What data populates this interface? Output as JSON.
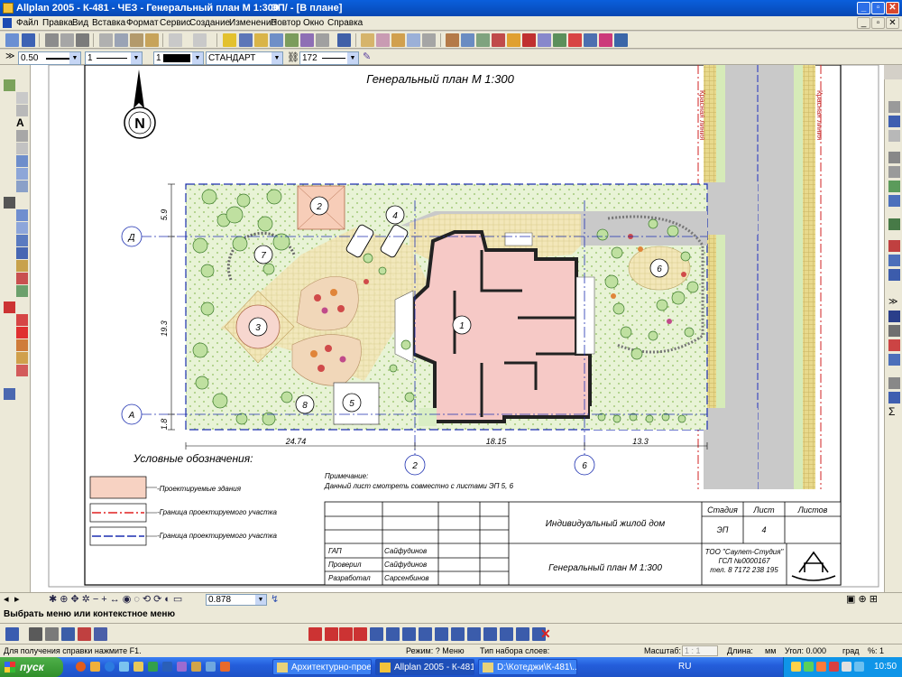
{
  "window": {
    "title": "Allplan 2005 - К-481 - ЧЕЗ - Генеральный план М 1:300",
    "doc_title": "ЭП/ - [В плане]"
  },
  "menu": [
    "Файл",
    "Правка",
    "Вид",
    "Вставка",
    "Формат",
    "Сервис",
    "Создание",
    "Изменение",
    "Повтор",
    "Окно",
    "Справка"
  ],
  "format_bar": {
    "pen": "0.50",
    "line": "1",
    "color": "1",
    "style": "СТАНДАРТ",
    "layer": "172"
  },
  "drawing": {
    "title": "Генеральный план М 1:300",
    "north": "N",
    "red_line_label": "Красная линия",
    "axis_d": "Д",
    "axis_a": "А",
    "axis_2": "2",
    "axis_6": "6",
    "dim_top": "5.9",
    "dim_mid": "19.3",
    "dim_bot": "1.8",
    "dim_w1": "24.74",
    "dim_w2": "18.15",
    "dim_w3": "13.3",
    "zone_labels": [
      "1",
      "2",
      "3",
      "4",
      "5",
      "6",
      "7",
      "8"
    ],
    "legend_title": "Условные обозначения:",
    "legend": [
      {
        "label": "-Проектируемые здания",
        "color": "#f6c9b8"
      },
      {
        "label": "-Граница проектируемого участка",
        "color": "#e02020"
      },
      {
        "label": "-Граница проектируемого участка",
        "color": "#1c2fb0"
      }
    ],
    "note_title": "Примечание:",
    "note_text": "Данный лист смотреть совместно с листами ЭП 5, 6",
    "stamp": {
      "stage_h": "Стадия",
      "sheet_h": "Лист",
      "sheets_h": "Листов",
      "stage": "ЭП",
      "sheet": "4",
      "project": "Индивидуальный жилой дом",
      "sheet_title": "Генеральный план М 1:300",
      "org1": "ТОО \"Саулет-Студия\"",
      "org2": "ГСЛ №0000167",
      "org3": "тел. 8 7172 238 195",
      "roles": [
        {
          "role": "ГАП",
          "name": "Сайфудинов"
        },
        {
          "role": "Проверил",
          "name": "Сайфудинов"
        },
        {
          "role": "Разработал",
          "name": "Сарсенбинов"
        }
      ]
    }
  },
  "zoom": "0.878",
  "prompt": "Выбрать меню или контекстное меню",
  "status": {
    "help": "Для получения справки нажмите F1.",
    "mode": "Режим: ? Меню",
    "set_type": "Тип набора слоев:",
    "scale_label": "Масштаб:",
    "scale": "1 : 1",
    "length_label": "Длина:",
    "length_unit": "мм",
    "angle_label": "Угол: 0.000",
    "angle_unit": "град",
    "percent": "%: 1"
  },
  "taskbar": {
    "start": "пуск",
    "items": [
      {
        "label": "Архитектурно-прое...",
        "active": false
      },
      {
        "label": "Allplan 2005 - К-481 -...",
        "active": true
      },
      {
        "label": "D:\\Котеджи\\К-481\\...",
        "active": false
      }
    ],
    "lang": "RU",
    "clock": "10:50"
  }
}
